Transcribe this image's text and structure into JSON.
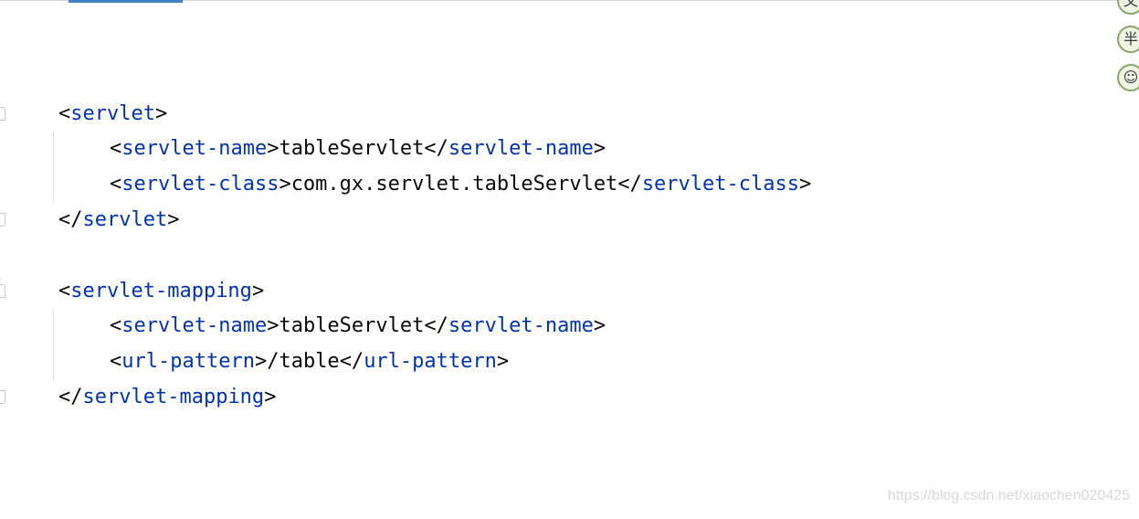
{
  "editor": {
    "lines": [
      {
        "open": "<",
        "tag": "servlet",
        "close": ">"
      },
      {
        "open": "<",
        "tag": "servlet-name",
        "mid": ">",
        "text": "tableServlet",
        "open2": "</",
        "tag2": "servlet-name",
        "close2": ">"
      },
      {
        "open": "<",
        "tag": "servlet-class",
        "mid": ">",
        "text": "com.gx.servlet.tableServlet",
        "open2": "</",
        "tag2": "servlet-class",
        "close2": ">"
      },
      {
        "open": "</",
        "tag": "servlet",
        "close": ">"
      },
      {
        "open": "<",
        "tag": "servlet-mapping",
        "close": ">"
      },
      {
        "open": "<",
        "tag": "servlet-name",
        "mid": ">",
        "text": "tableServlet",
        "open2": "</",
        "tag2": "servlet-name",
        "close2": ">"
      },
      {
        "open": "<",
        "tag": "url-pattern",
        "mid": ">",
        "text": "/table",
        "open2": "</",
        "tag2": "url-pattern",
        "close2": ">"
      },
      {
        "open": "</",
        "tag": "servlet-mapping",
        "close": ">"
      }
    ]
  },
  "side_icons": [
    {
      "glyph": "文",
      "icon": "translate-icon"
    },
    {
      "glyph": "半",
      "icon": "half-width-icon"
    },
    {
      "glyph": "☺",
      "icon": "emoji-icon"
    }
  ],
  "watermark": "https://blog.csdn.net/xiaochen020425",
  "colors": {
    "tag": "#0033b3",
    "text": "#080808",
    "tab_indicator": "#4083c9"
  }
}
